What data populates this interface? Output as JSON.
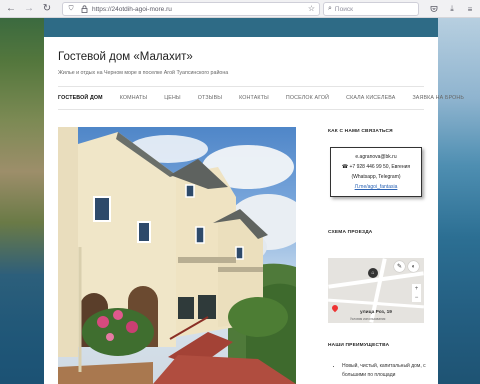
{
  "browser": {
    "url": "https://24otdih-agoi-more.ru",
    "search_placeholder": "Поиск"
  },
  "site": {
    "title": "Гостевой дом «Малахит»",
    "description": "Жилье и отдых на Черном море в поселке Агой Туапсинского района"
  },
  "nav": {
    "items": [
      {
        "label": "Гостевой дом",
        "active": true
      },
      {
        "label": "Комнаты"
      },
      {
        "label": "Цены"
      },
      {
        "label": "Отзывы"
      },
      {
        "label": "Контакты"
      },
      {
        "label": "Поселок Агой"
      },
      {
        "label": "Скала Киселева"
      },
      {
        "label": "Заявка на бронь"
      }
    ]
  },
  "sidebar": {
    "contact_heading": "Как с нами связаться",
    "email": "e.agranova@bk.ru",
    "phone": "☎ +7 928 446 99 50, Евгения",
    "messengers": "(Whatsapp, Telegram)",
    "links": "Л.me/agoi_fantasia",
    "map_heading": "Схема проезда",
    "map_address": "улица Роз, 19",
    "map_terms": "Условия использования",
    "advantages_heading": "Наши преимущества",
    "advantages": [
      "Новый, чистый, капитальный дом, с большими по площади"
    ]
  },
  "icons": {
    "back": "back-arrow-icon",
    "forward": "forward-arrow-icon",
    "reload": "reload-icon",
    "shield": "tracking-shield-icon",
    "lock": "lock-icon",
    "bookmark": "bookmark-star-icon",
    "search": "search-icon",
    "pocket": "pocket-icon",
    "downloads": "download-icon",
    "menu": "hamburger-menu-icon"
  },
  "colors": {
    "accent_link": "#2b63b4",
    "page_bg": "#ffffff"
  }
}
